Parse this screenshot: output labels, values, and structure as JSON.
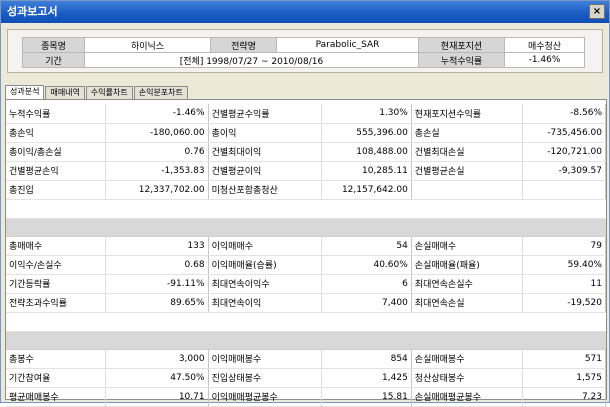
{
  "window": {
    "title": "성과보고서",
    "close_label": "×"
  },
  "info": {
    "stock_label": "종목명",
    "stock_value": "하이닉스",
    "strategy_label": "전략명",
    "strategy_value": "Parabolic_SAR",
    "position_label": "현재포지션",
    "position_value": "매수청산",
    "period_label": "기간",
    "period_value": "[전체] 1998/07/27  ~ 2010/08/16",
    "cum_return_label": "누적수익률",
    "cum_return_value": "-1.46%"
  },
  "tabs": [
    "성과분석",
    "매매내역",
    "수익률차트",
    "손익분포차트"
  ],
  "sections": [
    [
      [
        "누적수익률",
        "-1.46%",
        "건별평균수익률",
        "1.30%",
        "현재포지션수익률",
        "-8.56%"
      ],
      [
        "총손익",
        "-180,060.00",
        "총이익",
        "555,396.00",
        "총손실",
        "-735,456.00"
      ],
      [
        "총이익/총손실",
        "0.76",
        "건별최대이익",
        "108,488.00",
        "건별최대손실",
        "-120,721.00"
      ],
      [
        "건별평균손익",
        "-1,353.83",
        "건별평균이익",
        "10,285.11",
        "건별평균손실",
        "-9,309.57"
      ],
      [
        "총진입",
        "12,337,702.00",
        "미청산포함총청산",
        "12,157,642.00",
        "",
        ""
      ]
    ],
    [
      [
        "총매매수",
        "133",
        "이익매매수",
        "54",
        "손실매매수",
        "79"
      ],
      [
        "이익수/손실수",
        "0.68",
        "이익매매율(승률)",
        "40.60%",
        "손실매매율(패율)",
        "59.40%"
      ],
      [
        "기간등락률",
        "-91.11%",
        "최대연속이익수",
        "6",
        "최대연속손실수",
        "11"
      ],
      [
        "전략초과수익률",
        "89.65%",
        "최대연속이익",
        "7,400",
        "최대연속손실",
        "-19,520"
      ]
    ],
    [
      [
        "총봉수",
        "3,000",
        "이익매매봉수",
        "854",
        "손실매매봉수",
        "571"
      ],
      [
        "기간참여율",
        "47.50%",
        "진입상태봉수",
        "1,425",
        "청산상태봉수",
        "1,575"
      ],
      [
        "평균매매봉수",
        "10.71",
        "이익매매평균봉수",
        "15.81",
        "손실매매평균봉수",
        "7.23"
      ]
    ]
  ]
}
